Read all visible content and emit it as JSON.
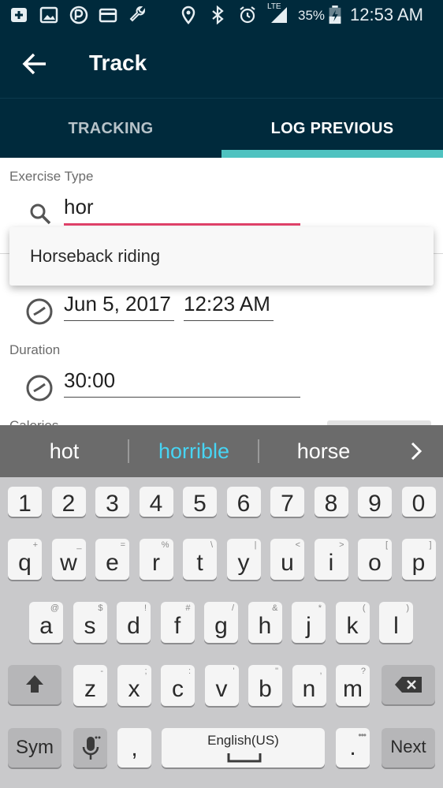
{
  "status_bar": {
    "battery": "35%",
    "network": "LTE",
    "time": "12:53 AM"
  },
  "app_bar": {
    "title": "Track"
  },
  "tabs": [
    {
      "label": "TRACKING",
      "selected": false
    },
    {
      "label": "LOG PREVIOUS",
      "selected": true
    }
  ],
  "form": {
    "exercise_label": "Exercise Type",
    "exercise_value": "hor",
    "autocomplete": [
      "Horseback riding"
    ],
    "start_date": "Jun 5, 2017",
    "start_time": "12:23 AM",
    "duration_label": "Duration",
    "duration_value": "30:00",
    "calories_label": "Calories"
  },
  "suggestions": [
    "hot",
    "horrible",
    "horse"
  ],
  "keyboard": {
    "numbers": [
      "1",
      "2",
      "3",
      "4",
      "5",
      "6",
      "7",
      "8",
      "9",
      "0"
    ],
    "row1": [
      {
        "k": "q",
        "h": "+"
      },
      {
        "k": "w",
        "h": "_"
      },
      {
        "k": "e",
        "h": "="
      },
      {
        "k": "r",
        "h": "%"
      },
      {
        "k": "t",
        "h": "\\"
      },
      {
        "k": "y",
        "h": "|"
      },
      {
        "k": "u",
        "h": "<"
      },
      {
        "k": "i",
        "h": ">"
      },
      {
        "k": "o",
        "h": "["
      },
      {
        "k": "p",
        "h": "]"
      }
    ],
    "row2": [
      {
        "k": "a",
        "h": "@"
      },
      {
        "k": "s",
        "h": "$"
      },
      {
        "k": "d",
        "h": "!"
      },
      {
        "k": "f",
        "h": "#"
      },
      {
        "k": "g",
        "h": "/"
      },
      {
        "k": "h",
        "h": "&"
      },
      {
        "k": "j",
        "h": "*"
      },
      {
        "k": "k",
        "h": "("
      },
      {
        "k": "l",
        "h": ")"
      }
    ],
    "row3": [
      {
        "k": "z",
        "h": "-"
      },
      {
        "k": "x",
        "h": ";"
      },
      {
        "k": "c",
        "h": ":"
      },
      {
        "k": "v",
        "h": "'"
      },
      {
        "k": "b",
        "h": "\""
      },
      {
        "k": "n",
        "h": ","
      },
      {
        "k": "m",
        "h": "?"
      }
    ],
    "sym_label": "Sym",
    "comma": ",",
    "space_label": "English(US)",
    "period": ".",
    "next_label": "Next"
  },
  "colors": {
    "header_bg": "#002a3c",
    "tab_indicator": "#4fc2c0",
    "active_underline": "#e2436b",
    "suggestion_highlight": "#47d4f3"
  }
}
